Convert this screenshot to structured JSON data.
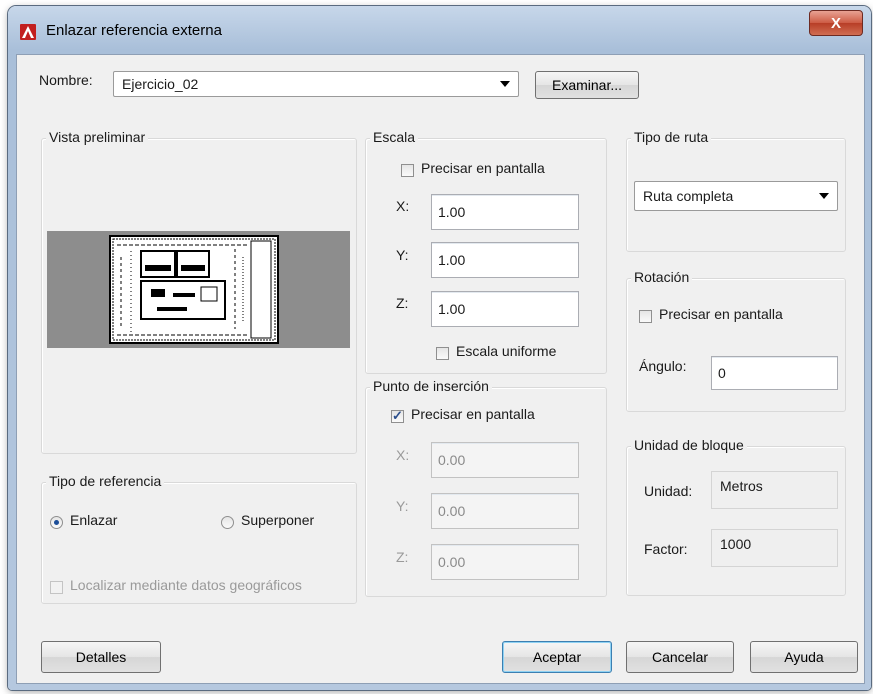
{
  "window": {
    "title": "Enlazar referencia externa",
    "close_glyph": "X",
    "app_icon": "autocad-icon"
  },
  "name_row": {
    "label": "Nombre:",
    "value": "Ejercicio_02",
    "browse_label": "Examinar..."
  },
  "preview": {
    "title": "Vista preliminar"
  },
  "reference_type": {
    "title": "Tipo de referencia",
    "attach_label": "Enlazar",
    "attach_selected": true,
    "overlay_label": "Superponer",
    "overlay_selected": false
  },
  "geo_locate": {
    "label": "Localizar mediante datos geográficos",
    "checked": false,
    "disabled": true
  },
  "scale": {
    "title": "Escala",
    "specify_label": "Precisar en pantalla",
    "specify_checked": false,
    "x_label": "X:",
    "x_value": "1.00",
    "y_label": "Y:",
    "y_value": "1.00",
    "z_label": "Z:",
    "z_value": "1.00",
    "uniform_label": "Escala uniforme",
    "uniform_checked": false
  },
  "insertion": {
    "title": "Punto de inserción",
    "specify_label": "Precisar en pantalla",
    "specify_checked": true,
    "x_label": "X:",
    "x_value": "0.00",
    "y_label": "Y:",
    "y_value": "0.00",
    "z_label": "Z:",
    "z_value": "0.00"
  },
  "path_type": {
    "title": "Tipo de ruta",
    "value": "Ruta completa"
  },
  "rotation": {
    "title": "Rotación",
    "specify_label": "Precisar en pantalla",
    "specify_checked": false,
    "angle_label": "Ángulo:",
    "angle_value": "0"
  },
  "block_unit": {
    "title": "Unidad de bloque",
    "unit_label": "Unidad:",
    "unit_value": "Metros",
    "factor_label": "Factor:",
    "factor_value": "1000"
  },
  "buttons": {
    "details": "Detalles",
    "ok": "Aceptar",
    "cancel": "Cancelar",
    "help": "Ayuda"
  },
  "colors": {
    "title_bar": "#b5c8df",
    "close_button": "#c9523b",
    "dialog_bg": "#f0f0f0",
    "preview_bg": "#8d8d8d"
  }
}
